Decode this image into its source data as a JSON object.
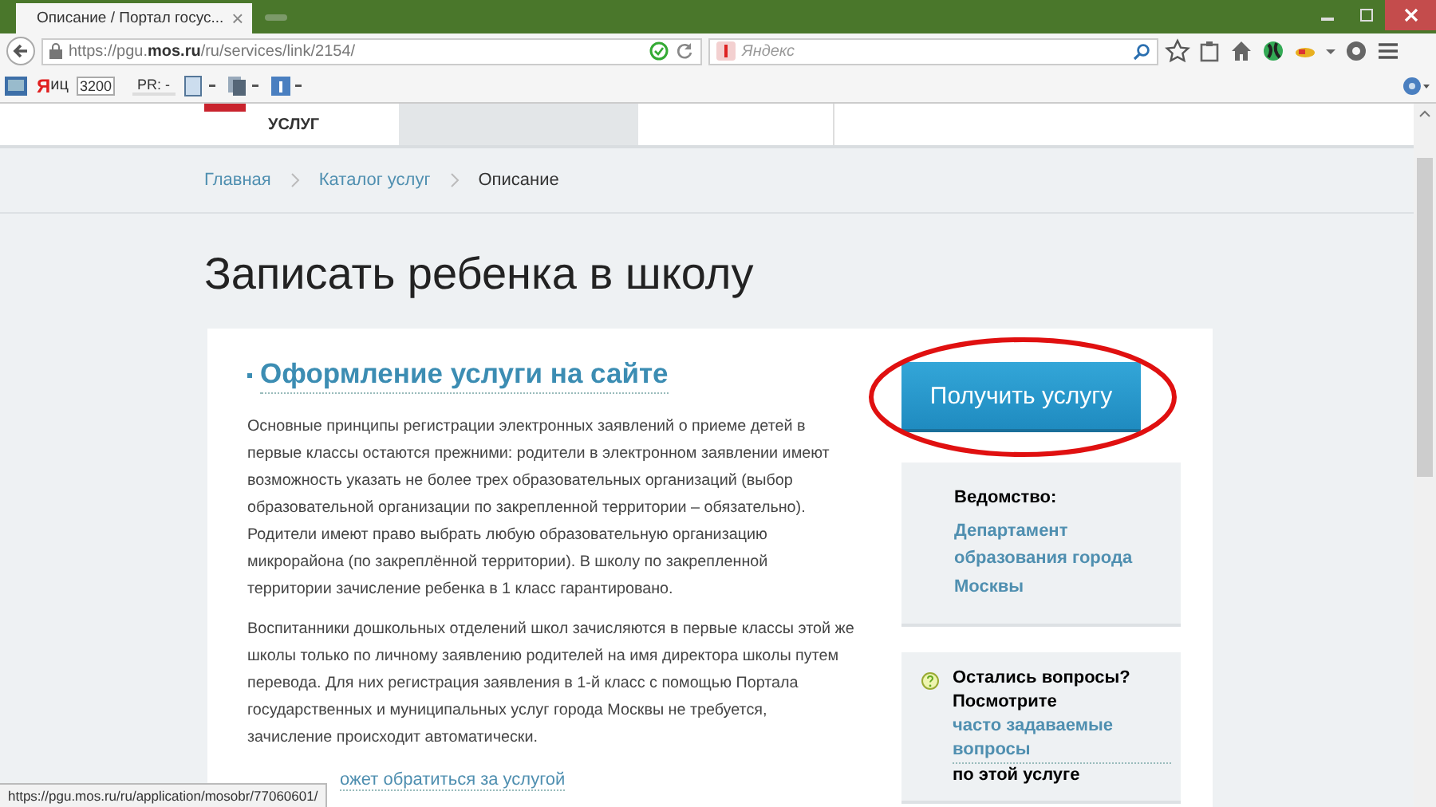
{
  "browser": {
    "tab": {
      "title": "Описание / Портал госус...",
      "close": "×",
      "selected": true
    },
    "address": "https://pgu.**mos.ru**/ru/services/link/2154/",
    "search": {
      "placeholder": "Яндекс"
    },
    "bookmarks": {
      "yandex_logo": "Я",
      "yandex_label": "иц",
      "yandex_count": "3200",
      "pr_label": "PR: -"
    }
  },
  "site_nav": {
    "logo_text": "УСЛУГ"
  },
  "breadcrumbs": [
    {
      "label": "Главная",
      "current": false
    },
    {
      "label": "Каталог услуг",
      "current": false
    },
    {
      "label": "Описание",
      "current": true
    }
  ],
  "page_title": "Записать ребенка в школу",
  "section": {
    "heading": "Оформление услуги на сайте",
    "paragraphs": [
      "Основные принципы регистрации электронных заявлений о приеме детей в первые классы остаются прежними: родители в электронном заявлении имеют возможность указать не более трех образовательных организаций (выбор образовательной организации по закрепленной территории – обязательно). Родители имеют право выбрать любую образовательную организацию микрорайона (по закреплённой территории). В школу по закрепленной территории зачисление ребенка в 1 класс гарантировано.",
      "Воспитанники дошкольных отделений школ зачисляются в первые классы этой же школы только по личному заявлению родителей на имя директора школы путем перевода. Для них регистрация заявления в 1-й класс с помощью Портала государственных и муниципальных услуг города Москвы не требуется, зачисление происходит автоматически."
    ],
    "cut_link": "ожет обратиться за услугой"
  },
  "sidebar": {
    "button": "Получить услугу",
    "highlighted": true,
    "agency_label": "Ведомство:",
    "agency_link": "Департамент образования города Москвы",
    "faq": {
      "lead": "Остались вопросы?",
      "prefix": "Посмотрите",
      "link": "часто задаваемые вопросы",
      "suffix": "по этой услуге"
    }
  },
  "status_url": "https://pgu.mos.ru/ru/application/mosobr/77060601/"
}
